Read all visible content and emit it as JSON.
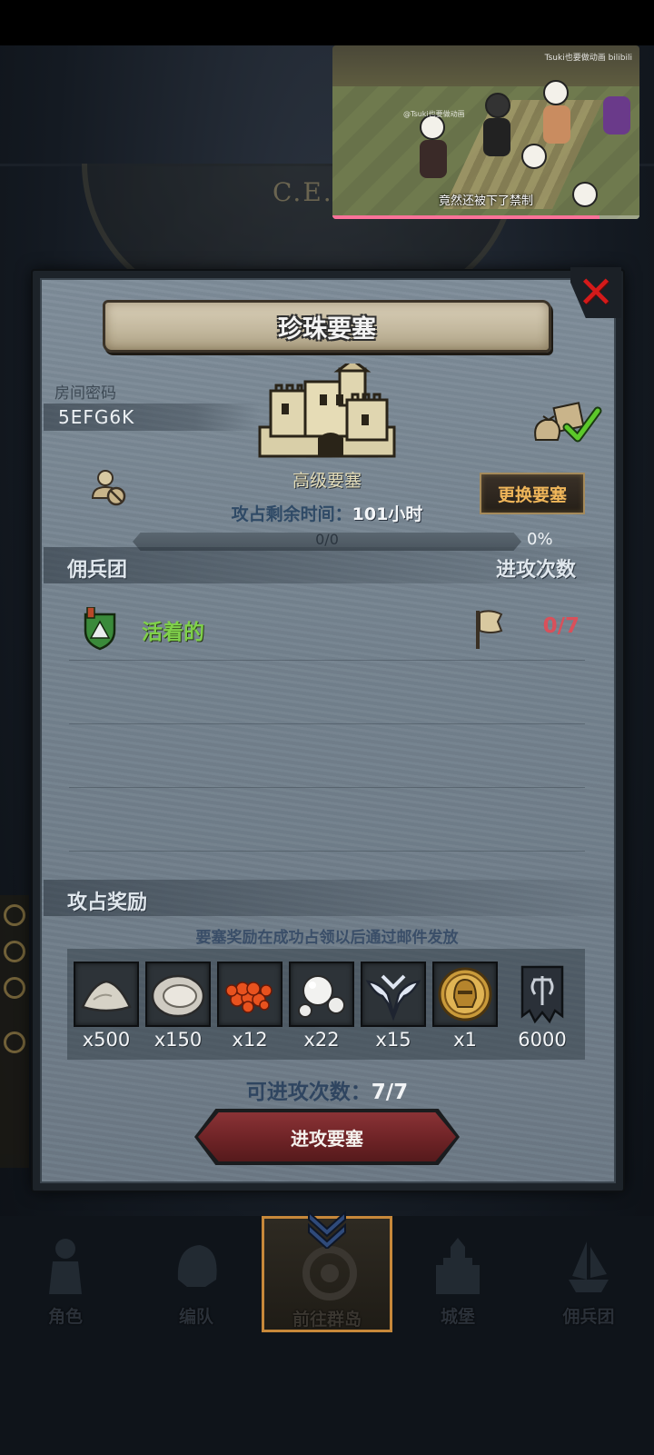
{
  "video": {
    "watermark": "Tsuki也要做动画 bilibili",
    "uploader_tag": "@Tsuki也要做动画",
    "caption": "竟然还被下了禁制",
    "progress": 0.87
  },
  "background": {
    "dial_text": "C.E.2"
  },
  "dialog": {
    "title": "珍珠要塞",
    "room_code_label": "房间密码",
    "room_code": "5EFG6K",
    "fortress_level": "高级要塞",
    "change_button": "更换要塞",
    "time_left_label": "攻占剩余时间：",
    "time_left_value": "101小时",
    "progress_text": "0/0",
    "progress_percent": "0%",
    "progress_fraction": 0,
    "mercenary_header": "佣兵团",
    "attack_count_header": "进攻次数",
    "mercenary_row": {
      "name": "活着的",
      "attacks": "0/7"
    },
    "rewards_header": "攻占奖励",
    "rewards_note": "要塞奖励在成功占领以后通过邮件发放",
    "rewards": [
      {
        "icon": "salt-pile-icon",
        "count": "x500"
      },
      {
        "icon": "oyster-icon",
        "count": "x150"
      },
      {
        "icon": "caviar-icon",
        "count": "x12"
      },
      {
        "icon": "pearls-icon",
        "count": "x22"
      },
      {
        "icon": "winged-emblem-icon",
        "count": "x15"
      },
      {
        "icon": "golden-helmet-medal-icon",
        "count": "x1"
      },
      {
        "icon": "guild-banner-icon",
        "count": "6000"
      }
    ],
    "attacks_available_label": "可进攻次数：",
    "attacks_available_value": "7/7",
    "attack_button": "进攻要塞"
  },
  "bottom_nav": [
    {
      "label": "角色",
      "icon": "knight-icon",
      "active": false
    },
    {
      "label": "编队",
      "icon": "helmet-icon",
      "active": false
    },
    {
      "label": "前往群岛",
      "icon": "compass-icon",
      "active": true
    },
    {
      "label": "城堡",
      "icon": "castle-icon",
      "active": false
    },
    {
      "label": "佣兵团",
      "icon": "ship-icon",
      "active": false
    }
  ],
  "colors": {
    "merc_name": "#7fd04a",
    "attack_count": "#d9505a",
    "change_button_text": "#f0b65a",
    "close_icon": "#d41a1a",
    "attack_button": "#7a2a2d",
    "active_nav_border": "#c7883a"
  }
}
